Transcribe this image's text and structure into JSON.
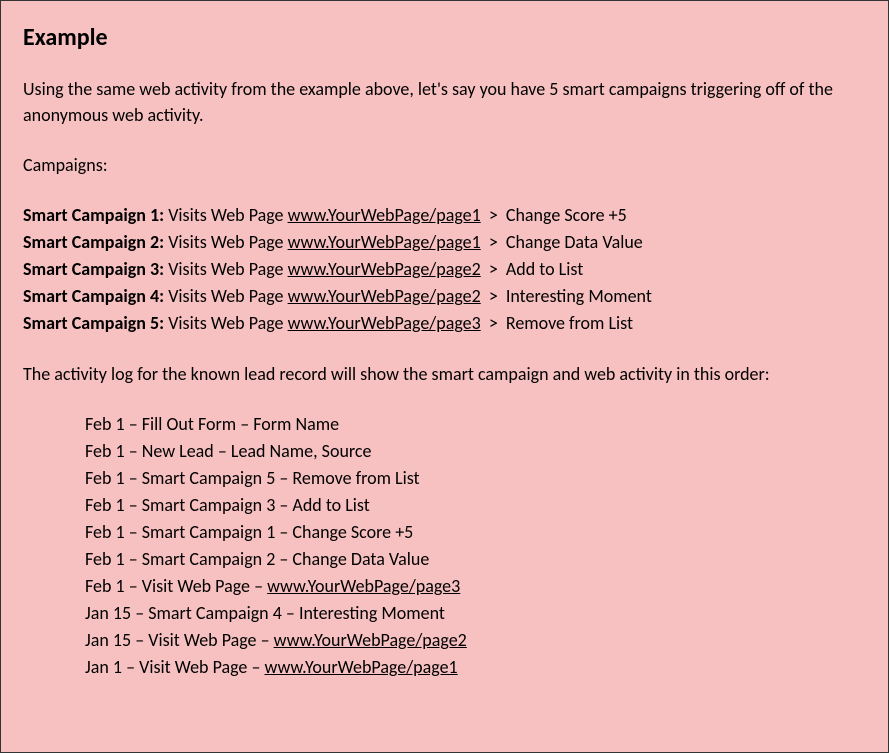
{
  "title": "Example",
  "intro": "Using the same web activity from the example above, let's say you have 5 smart campaigns triggering off of the anonymous web activity.",
  "subhead": "Campaigns:",
  "campaigns": [
    {
      "label": "Smart Campaign 1:",
      "prefix": "Visits Web Page ",
      "url": "www.YourWebPage/page1",
      "action": "Change Score +5"
    },
    {
      "label": "Smart Campaign 2:",
      "prefix": "Visits Web Page ",
      "url": "www.YourWebPage/page1",
      "action": "Change Data Value"
    },
    {
      "label": "Smart Campaign 3:",
      "prefix": "Visits Web Page ",
      "url": "www.YourWebPage/page2",
      "action": "Add to List"
    },
    {
      "label": "Smart Campaign 4:",
      "prefix": "Visits Web Page ",
      "url": "www.YourWebPage/page2",
      "action": "Interesting Moment"
    },
    {
      "label": "Smart Campaign 5:",
      "prefix": "Visits Web Page ",
      "url": "www.YourWebPage/page3",
      "action": "Remove from List"
    }
  ],
  "outro": "The activity log for the known lead record will show the smart campaign and web activity in this order:",
  "activity_log": [
    {
      "date": "Feb 1",
      "event": "Fill Out Form",
      "detail": "Form Name",
      "underlined": false
    },
    {
      "date": "Feb 1",
      "event": "New Lead",
      "detail": "Lead Name, Source",
      "underlined": false
    },
    {
      "date": "Feb 1",
      "event": "Smart Campaign 5",
      "detail": "Remove from List",
      "underlined": false
    },
    {
      "date": "Feb 1",
      "event": "Smart Campaign 3",
      "detail": "Add to List",
      "underlined": false
    },
    {
      "date": "Feb 1",
      "event": "Smart Campaign 1",
      "detail": "Change Score +5",
      "underlined": false
    },
    {
      "date": "Feb 1",
      "event": "Smart Campaign 2",
      "detail": "Change Data Value",
      "underlined": false
    },
    {
      "date": "Feb 1",
      "event": "Visit Web Page",
      "detail": "www.YourWebPage/page3",
      "underlined": true
    },
    {
      "date": "Jan 15",
      "event": "Smart Campaign 4",
      "detail": "Interesting Moment",
      "underlined": false
    },
    {
      "date": "Jan 15",
      "event": "Visit Web Page",
      "detail": "www.YourWebPage/page2",
      "underlined": true
    },
    {
      "date": "Jan 1",
      "event": "Visit Web Page",
      "detail": "www.YourWebPage/page1",
      "underlined": true
    }
  ],
  "dash": " – ",
  "gt": ">"
}
